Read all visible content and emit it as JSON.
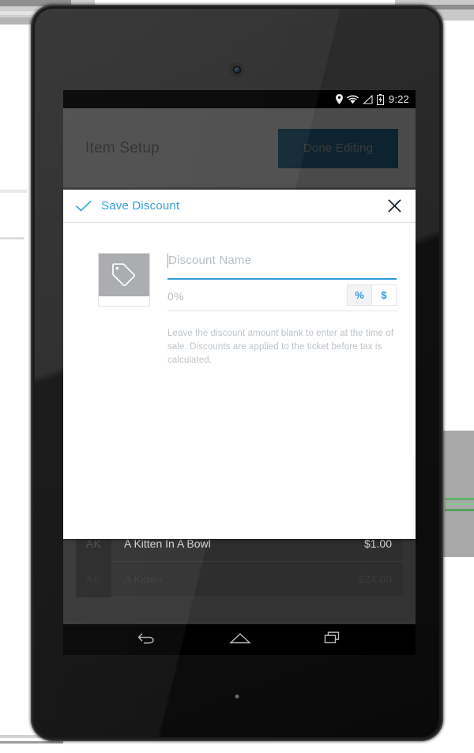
{
  "device": {
    "type": "android-tablet",
    "camera_label": "front-camera",
    "led_label": "notification-led"
  },
  "statusbar": {
    "icons": [
      "location-pin-icon",
      "wifi-icon",
      "signal-icon",
      "battery-charging-icon"
    ],
    "time": "9:22"
  },
  "appbar": {
    "title": "Item Setup",
    "done_label": "Done Editing",
    "button_color": "#0d2430"
  },
  "dialog": {
    "title": "Save Discount",
    "accent_color": "#2a9ad8",
    "check_icon": "check-icon",
    "close_icon": "close-icon",
    "thumbnail_icon": "price-tag-icon",
    "name_field": {
      "value": "",
      "placeholder": "Discount Name",
      "focused": true
    },
    "amount_field": {
      "value": "",
      "placeholder": "0%"
    },
    "toggle": {
      "options": [
        "%",
        "$"
      ],
      "selected": "%"
    },
    "helper_text": "Leave the discount amount blank to enter at the time of sale. Discounts are applied to the ticket before tax is calculated."
  },
  "background_list": {
    "rows": [
      {
        "initials": "AK",
        "name": "A Kitten In A Bowl",
        "price": "$1.00"
      },
      {
        "initials": "AK",
        "name": "A Kitten",
        "price": "$24.00"
      }
    ]
  },
  "navbar": {
    "items": [
      "back-icon",
      "home-icon",
      "recents-icon"
    ]
  }
}
